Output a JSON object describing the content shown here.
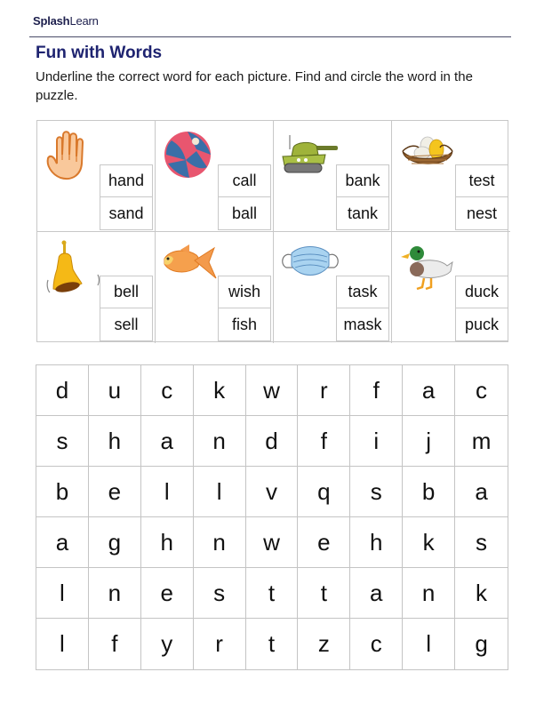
{
  "header": {
    "brand_bold": "Splash",
    "brand_light": "Learn",
    "title": "Fun with Words",
    "instructions": "Underline the correct word for each picture. Find and circle the word in the puzzle."
  },
  "colors": {
    "title": "#1e2370",
    "brand": "#1d1f4d",
    "border": "#c8c8c8"
  },
  "cards": [
    {
      "picture": "hand-icon",
      "words": [
        "hand",
        "sand"
      ]
    },
    {
      "picture": "beach-ball-icon",
      "words": [
        "call",
        "ball"
      ]
    },
    {
      "picture": "tank-icon",
      "words": [
        "bank",
        "tank"
      ]
    },
    {
      "picture": "nest-icon",
      "words": [
        "test",
        "nest"
      ]
    },
    {
      "picture": "bell-icon",
      "words": [
        "bell",
        "sell"
      ]
    },
    {
      "picture": "fish-icon",
      "words": [
        "wish",
        "fish"
      ]
    },
    {
      "picture": "mask-icon",
      "words": [
        "task",
        "mask"
      ]
    },
    {
      "picture": "duck-icon",
      "words": [
        "duck",
        "puck"
      ]
    }
  ],
  "puzzle": {
    "rows": [
      [
        "d",
        "u",
        "c",
        "k",
        "w",
        "r",
        "f",
        "a",
        "c"
      ],
      [
        "s",
        "h",
        "a",
        "n",
        "d",
        "f",
        "i",
        "j",
        "m"
      ],
      [
        "b",
        "e",
        "l",
        "l",
        "v",
        "q",
        "s",
        "b",
        "a"
      ],
      [
        "a",
        "g",
        "h",
        "n",
        "w",
        "e",
        "h",
        "k",
        "s"
      ],
      [
        "l",
        "n",
        "e",
        "s",
        "t",
        "t",
        "a",
        "n",
        "k"
      ],
      [
        "l",
        "f",
        "y",
        "r",
        "t",
        "z",
        "c",
        "l",
        "g"
      ]
    ]
  }
}
